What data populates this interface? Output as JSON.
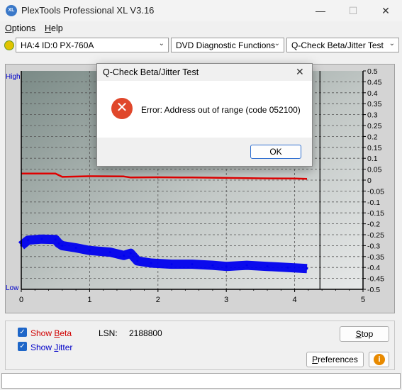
{
  "window": {
    "title": "PlexTools Professional XL V3.16",
    "icon_text": "XL",
    "minimize_glyph": "—",
    "maximize_glyph": "☐",
    "close_glyph": "✕"
  },
  "menu": [
    {
      "label": "Options",
      "accel": "O",
      "rest": "ptions"
    },
    {
      "label": "Help",
      "accel": "H",
      "rest": "elp"
    }
  ],
  "toolbar": {
    "drive": "HA:4 ID:0  PX-760A",
    "function": "DVD Diagnostic Functions",
    "test": "Q-Check Beta/Jitter Test",
    "arrow_glyph": "⌄"
  },
  "chart_data": {
    "type": "line",
    "left_axis_labels": {
      "top": "High",
      "bottom": "Low"
    },
    "xlim": [
      0,
      5
    ],
    "x_ticks": [
      "0",
      "1",
      "2",
      "3",
      "4",
      "5"
    ],
    "ylim": [
      -0.5,
      0.5
    ],
    "y_ticks": [
      "0.5",
      "0.45",
      "0.4",
      "0.35",
      "0.3",
      "0.25",
      "0.2",
      "0.15",
      "0.1",
      "0.05",
      "0",
      "-0.05",
      "-0.1",
      "-0.15",
      "-0.2",
      "-0.25",
      "-0.3",
      "-0.35",
      "-0.4",
      "-0.45",
      "-0.5"
    ],
    "grid": true,
    "end_marker_x": 4.37,
    "series": [
      {
        "color": "#e00000",
        "x": [
          0,
          0.3,
          0.5,
          0.6,
          1.0,
          1.5,
          1.6,
          2.0,
          2.5,
          3.0,
          3.5,
          4.0,
          4.18
        ],
        "y": [
          0.03,
          0.03,
          0.03,
          0.015,
          0.018,
          0.017,
          0.012,
          0.013,
          0.012,
          0.01,
          0.008,
          0.007,
          0.006
        ]
      },
      {
        "color": "#0000ee",
        "x": [
          0,
          0.1,
          0.3,
          0.5,
          0.55,
          0.6,
          0.8,
          1.0,
          1.3,
          1.5,
          1.6,
          1.7,
          1.9,
          2.2,
          2.5,
          2.8,
          3.0,
          3.3,
          3.6,
          3.9,
          4.18
        ],
        "y": [
          -0.3,
          -0.275,
          -0.27,
          -0.272,
          -0.29,
          -0.3,
          -0.31,
          -0.322,
          -0.33,
          -0.345,
          -0.335,
          -0.37,
          -0.38,
          -0.385,
          -0.385,
          -0.39,
          -0.395,
          -0.39,
          -0.395,
          -0.4,
          -0.405
        ]
      }
    ]
  },
  "dialog": {
    "title": "Q-Check Beta/Jitter Test",
    "close_glyph": "✕",
    "icon_glyph": "✕",
    "message": "Error: Address out of range (code 052100)",
    "ok_label": "OK"
  },
  "controls": {
    "check_glyph": "✓",
    "show_beta": {
      "prefix": "Show ",
      "accel": "B",
      "rest": "eta",
      "color": "#d00000"
    },
    "show_jitter": {
      "prefix": "Show ",
      "accel": "J",
      "rest": "itter",
      "color": "#0000c8"
    },
    "lsn_label": "LSN:",
    "lsn_value": "2188800",
    "stop": {
      "accel": "S",
      "rest": "top"
    },
    "preferences": {
      "accel": "P",
      "rest": "references"
    },
    "info_glyph": "i"
  }
}
